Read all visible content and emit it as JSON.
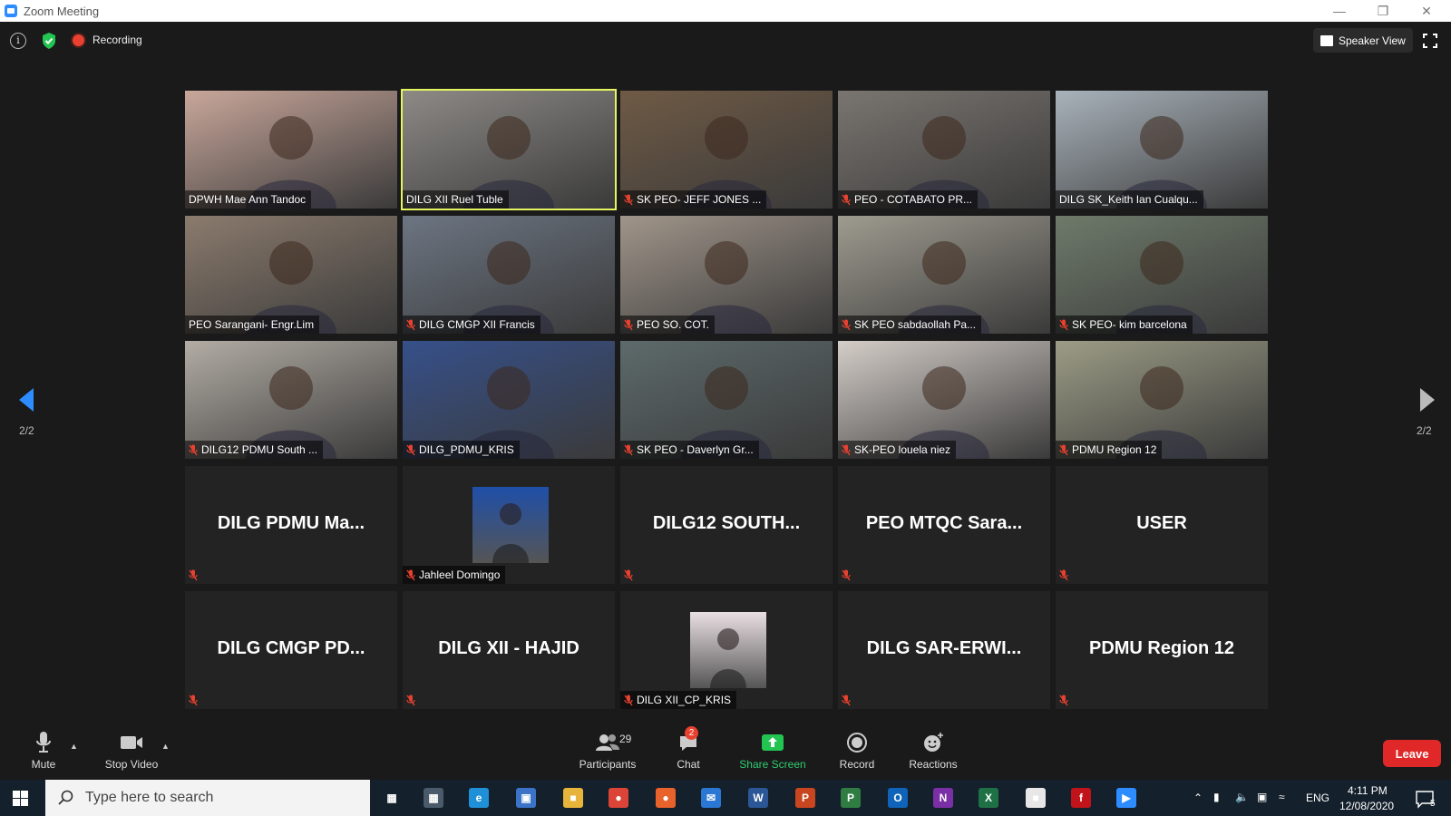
{
  "window": {
    "title": "Zoom Meeting",
    "controls": [
      "minimize",
      "restore",
      "close"
    ]
  },
  "topbar": {
    "recording_label": "Recording",
    "speaker_view_label": "Speaker View"
  },
  "gallery": {
    "page_indicator_left": "2/2",
    "page_indicator_right": "2/2",
    "tiles": [
      {
        "name": "DPWH Mae Ann Tandoc",
        "muted": false,
        "kind": "video",
        "bg": "#c9a79b"
      },
      {
        "name": "DILG XII Ruel Tuble",
        "muted": false,
        "kind": "video",
        "bg": "#8d8a86",
        "active": true
      },
      {
        "name": "SK PEO- JEFF JONES ...",
        "muted": true,
        "kind": "video",
        "bg": "#6f5a45"
      },
      {
        "name": "PEO - COTABATO  PR...",
        "muted": true,
        "kind": "video",
        "bg": "#7a7570"
      },
      {
        "name": "DILG SK_Keith Ian Cualqu...",
        "muted": false,
        "kind": "video",
        "bg": "#a9b3bb"
      },
      {
        "name": "PEO Sarangani- Engr.Lim",
        "muted": false,
        "kind": "video",
        "bg": "#8b7b6d"
      },
      {
        "name": "DILG CMGP XII Francis",
        "muted": true,
        "kind": "video",
        "bg": "#6c7582"
      },
      {
        "name": "PEO SO. COT.",
        "muted": true,
        "kind": "video",
        "bg": "#a0958a"
      },
      {
        "name": "SK PEO sabdaollah Pa...",
        "muted": true,
        "kind": "video",
        "bg": "#9e9b8f"
      },
      {
        "name": "SK PEO- kim barcelona",
        "muted": true,
        "kind": "video",
        "bg": "#6e7a6a"
      },
      {
        "name": "DILG12 PDMU South ...",
        "muted": true,
        "kind": "video",
        "bg": "#b2aca4"
      },
      {
        "name": "DILG_PDMU_KRIS",
        "muted": true,
        "kind": "video",
        "bg": "#36508a"
      },
      {
        "name": "SK PEO - Daverlyn Gr...",
        "muted": true,
        "kind": "video",
        "bg": "#5d6a6b"
      },
      {
        "name": "SK-PEO louela niez",
        "muted": true,
        "kind": "video",
        "bg": "#d4cdc8"
      },
      {
        "name": "PDMU Region 12",
        "muted": true,
        "kind": "video",
        "bg": "#9c9c86"
      },
      {
        "name": "DILG PDMU Ma...",
        "muted": true,
        "kind": "name"
      },
      {
        "name": "Jahleel Domingo",
        "muted": true,
        "kind": "photo",
        "bg": "#1f4fa8"
      },
      {
        "name": "DILG12 SOUTH...",
        "muted": true,
        "kind": "name"
      },
      {
        "name": "PEO MTQC Sara...",
        "muted": true,
        "kind": "name"
      },
      {
        "name": "USER",
        "muted": true,
        "kind": "name"
      },
      {
        "name": "DILG CMGP PD...",
        "muted": true,
        "kind": "name"
      },
      {
        "name": "DILG XII - HAJID",
        "muted": true,
        "kind": "name"
      },
      {
        "name": "DILG XII_CP_KRIS",
        "muted": true,
        "kind": "photo",
        "bg": "#e9dfe3"
      },
      {
        "name": "DILG  SAR-ERWI...",
        "muted": true,
        "kind": "name"
      },
      {
        "name": "PDMU Region 12",
        "muted": true,
        "kind": "name"
      }
    ]
  },
  "toolbar": {
    "mute_label": "Mute",
    "stop_video_label": "Stop Video",
    "participants_label": "Participants",
    "participants_count": "29",
    "chat_label": "Chat",
    "chat_badge": "2",
    "share_screen_label": "Share Screen",
    "record_label": "Record",
    "reactions_label": "Reactions",
    "leave_label": "Leave"
  },
  "taskbar": {
    "search_placeholder": "Type here to search",
    "language": "ENG",
    "time": "4:11 PM",
    "date": "12/08/2020",
    "notification_count": "5",
    "apps": [
      "task-view",
      "calculator",
      "edge",
      "store",
      "file-explorer",
      "chrome",
      "firefox",
      "mail",
      "word",
      "powerpoint",
      "project",
      "outlook",
      "onenote",
      "excel",
      "paint",
      "flash",
      "zoom"
    ]
  },
  "colors": {
    "accent": "#2d8cff",
    "active_speaker": "#e5f560",
    "leave": "#e02828",
    "share": "#2ecc71",
    "muted": "#e8412f"
  }
}
